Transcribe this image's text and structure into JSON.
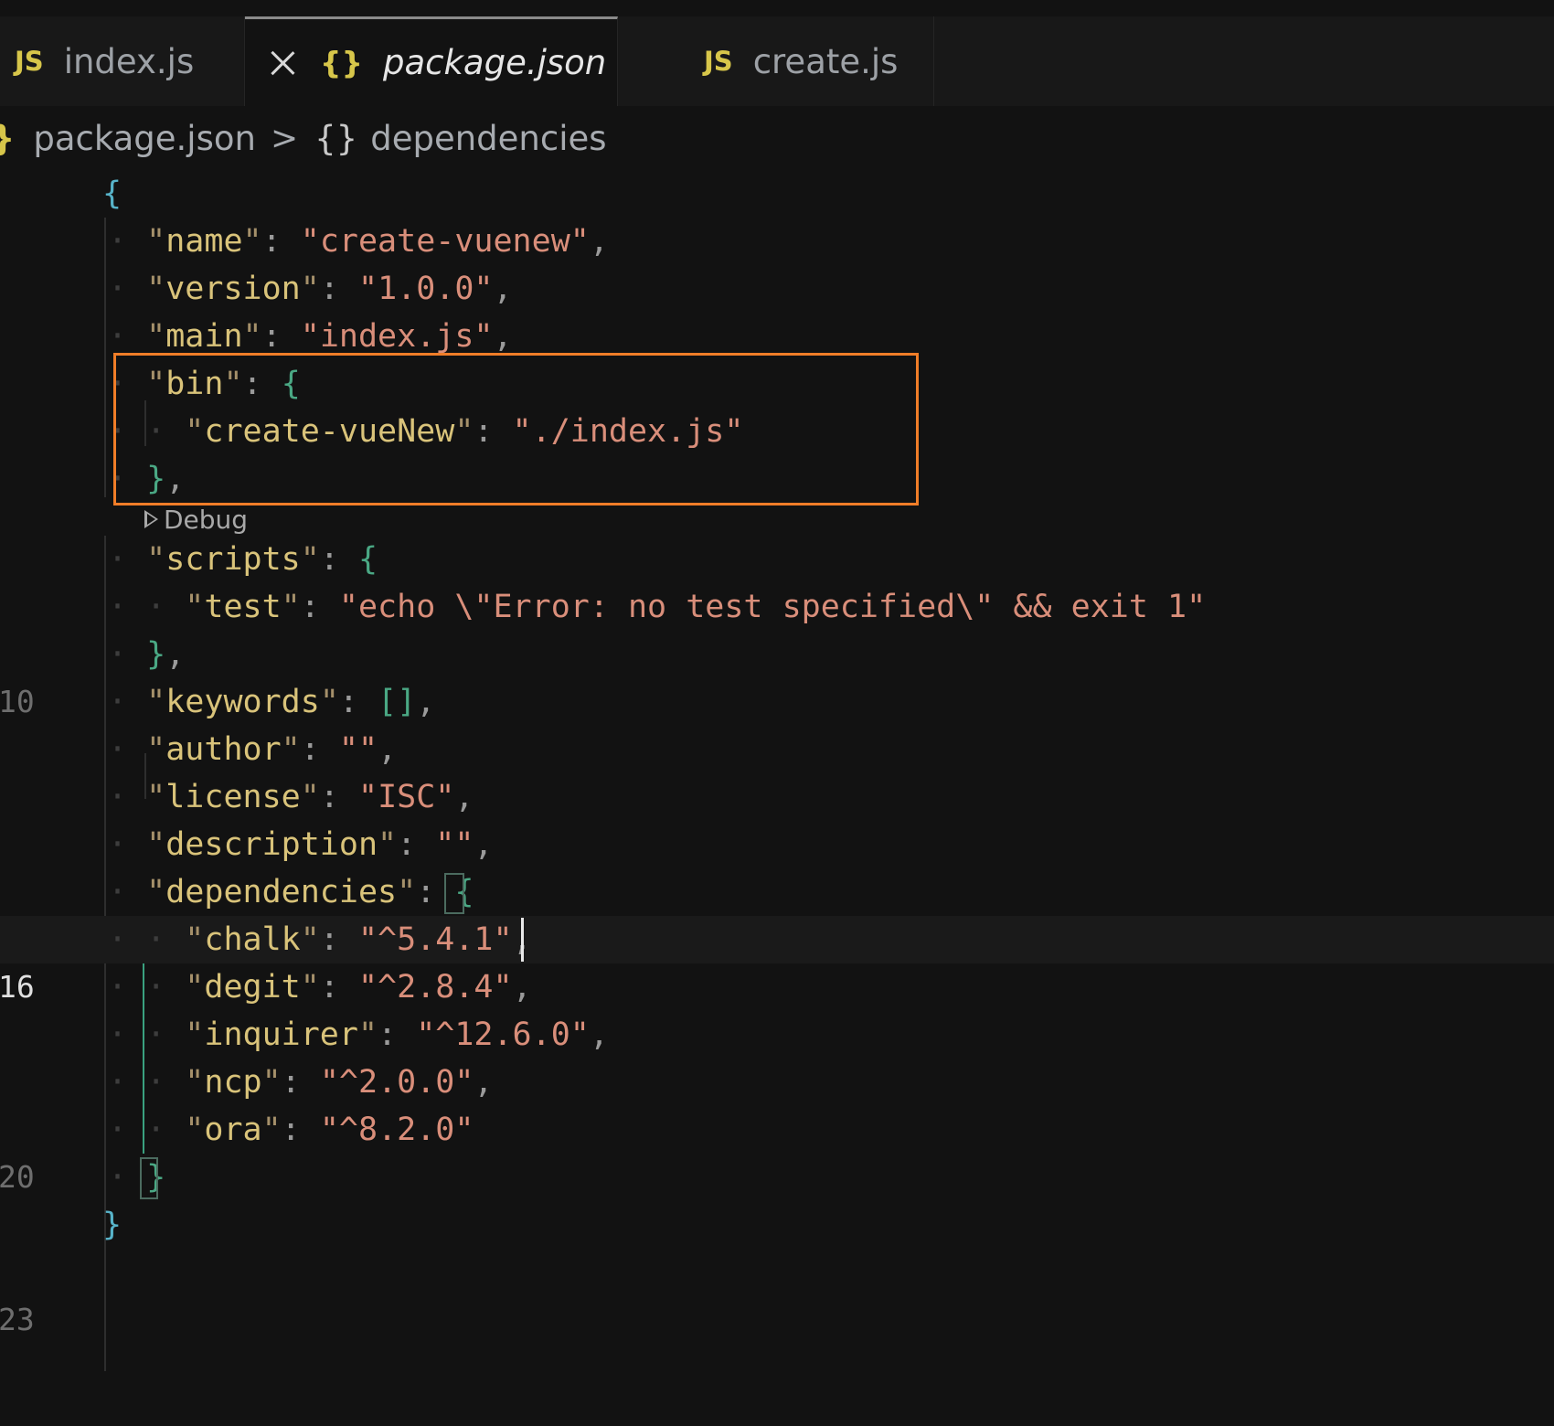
{
  "tabs": [
    {
      "icon": "JS",
      "label": "index.js"
    },
    {
      "icon": "{}",
      "label": "package.json",
      "active": true
    },
    {
      "icon": "JS",
      "label": "create.js"
    }
  ],
  "breadcrumb": {
    "file_icon": "}",
    "file": "package.json",
    "separator": ">",
    "object_icon": "{}",
    "symbol": "dependencies"
  },
  "codelens": {
    "label": "Debug"
  },
  "line_numbers": {
    "l10": "10",
    "l16": "16",
    "l20": "20",
    "l23": "23"
  },
  "code": {
    "open_brace": "{",
    "name_key": "name",
    "name_val": "create-vuenew",
    "version_key": "version",
    "version_val": "1.0.0",
    "main_key": "main",
    "main_val": "index.js",
    "bin_key": "bin",
    "bin_cmd_key": "create-vueNew",
    "bin_cmd_val": "./index.js",
    "scripts_key": "scripts",
    "test_key": "test",
    "test_val": "echo \\\"Error: no test specified\\\" && exit 1",
    "keywords_key": "keywords",
    "keywords_val": "[]",
    "author_key": "author",
    "license_key": "license",
    "license_val": "ISC",
    "description_key": "description",
    "dependencies_key": "dependencies",
    "deps": [
      {
        "key": "chalk",
        "val": "^5.4.1"
      },
      {
        "key": "degit",
        "val": "^2.8.4"
      },
      {
        "key": "inquirer",
        "val": "^12.6.0"
      },
      {
        "key": "ncp",
        "val": "^2.0.0"
      },
      {
        "key": "ora",
        "val": "^8.2.0"
      }
    ],
    "close_brace": "}"
  },
  "colors": {
    "background": "#121212",
    "key": "#d9c37a",
    "string": "#d98e7a",
    "bracket_outer": "#57b3c9",
    "bracket_inner": "#4aa884",
    "highlight_box": "#f07d28",
    "js_icon": "#d7c64a"
  }
}
